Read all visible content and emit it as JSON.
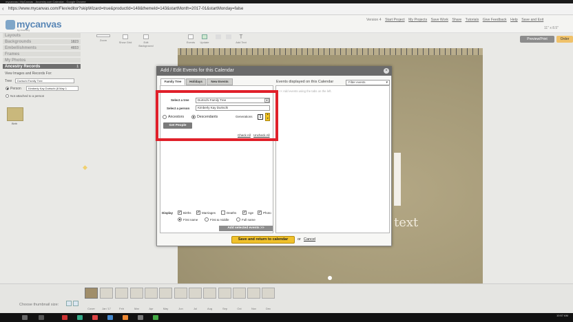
{
  "browser": {
    "title_strip": "mycanvas | MyCanvas - Ancestry.com Calendar - Google Chrome",
    "url": "https://www.mycanvas.com/Flex/editor?skipWizard=true&productId=148&themeId=143&startMonth=2017-01&startMonday=false"
  },
  "brand": {
    "name": "mycanvas",
    "tagline": "by Ancestry"
  },
  "toplinks": {
    "version": "Version 4",
    "items": [
      "Start Project",
      "My Projects",
      "Save Work",
      "Share",
      "Tutorials",
      "Give Feedback",
      "Help",
      "Save and Exit"
    ]
  },
  "size_label": "11\" x 8.5\"",
  "toolbar": {
    "tools": [
      "Zoom",
      "Show Grid",
      "Edit Background",
      "Events",
      "Update",
      "",
      "",
      "Add Text"
    ],
    "preview_label": "Preview/Print",
    "order_label": "Order"
  },
  "sidebar": {
    "rows": [
      {
        "label": "Layouts",
        "count": ""
      },
      {
        "label": "Backgrounds",
        "count": "1823"
      },
      {
        "label": "Embellishments",
        "count": "4653"
      },
      {
        "label": "Frames",
        "count": ""
      },
      {
        "label": "My Photos",
        "count": ""
      },
      {
        "label": "Ancestry Records",
        "count": "1"
      }
    ],
    "view_label": "View Images and Records For:",
    "tree_label": "Tree",
    "tree_value": "Durtschi Family Tree",
    "person_label": "Person",
    "person_value": "Kimberly Kay Durtschi (8 May 1",
    "not_attached_label": "Not attached to a person",
    "card_label": "Birth"
  },
  "modal": {
    "title": "Add / Edit Events for this Calendar",
    "tabs": [
      "Family Tree",
      "Holidays",
      "New Events"
    ],
    "select_tree_label": "Select a tree",
    "tree_value": "Durtschi Family Tree",
    "select_person_label": "Select a person",
    "person_value": "Kimberly Kay Durtschi",
    "ancestors_label": "Ancestors",
    "descendants_label": "Descendants",
    "generations_label": "Generations",
    "generations_value": "1",
    "get_people_label": "Get People",
    "check_all": "Check All",
    "uncheck_all": "Uncheck All",
    "display_label": "Display",
    "display_options": [
      "Births",
      "Marriages",
      "Deaths",
      "Age",
      "Photo"
    ],
    "name_options": [
      "First name",
      "First & middle",
      "Full name"
    ],
    "add_selected": "Add selected events >>",
    "events_label": "Events displayed on this Calendar",
    "filter_label": "Filter events",
    "events_hint": "<< Add events using the tabs on the left.",
    "save_label": "Save and return to calendar",
    "or_label": "or",
    "cancel_label": "Cancel"
  },
  "calendar": {
    "placeholder_text": "text"
  },
  "thumbs": {
    "size_label": "Choose thumbnail size:",
    "labels": [
      "Cover",
      "Jan '17",
      "Feb",
      "Mar",
      "Apr",
      "May",
      "Jun",
      "Jul",
      "Aug",
      "Sep",
      "Oct",
      "Nov",
      "Dec"
    ]
  },
  "taskbar": {
    "time": "10:57 AM"
  },
  "colors": {
    "highlight": "#e0202a",
    "save_button": "#f0c12b",
    "brand_blue": "#5a87b6"
  }
}
